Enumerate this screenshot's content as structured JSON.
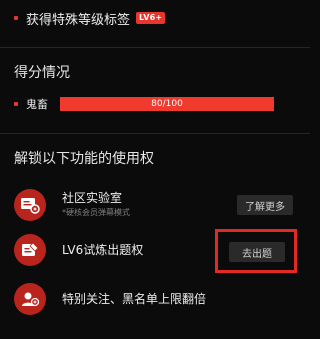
{
  "header": {
    "text": "获得特殊等级标签",
    "badge": "LV6+"
  },
  "score_section": {
    "title": "得分情况",
    "label": "鬼畜",
    "value": 80,
    "max": 100,
    "display": "80/100",
    "bar_color": "#f03a2e"
  },
  "unlock_section": {
    "title": "解锁以下功能的使用权",
    "features": [
      {
        "icon": "community-lab-icon",
        "title": "社区实验室",
        "subtitle": "*硬核会员弹幕模式",
        "button": "了解更多"
      },
      {
        "icon": "pencil-quiz-icon",
        "title": "LV6试炼出题权",
        "button": "去出题"
      },
      {
        "icon": "user-follow-icon",
        "title": "特别关注、黑名单上限翻倍"
      }
    ]
  },
  "colors": {
    "accent": "#e8352d",
    "icon_bg": "#b9241d",
    "highlight": "#e12a20",
    "background": "#0b0b0b"
  }
}
